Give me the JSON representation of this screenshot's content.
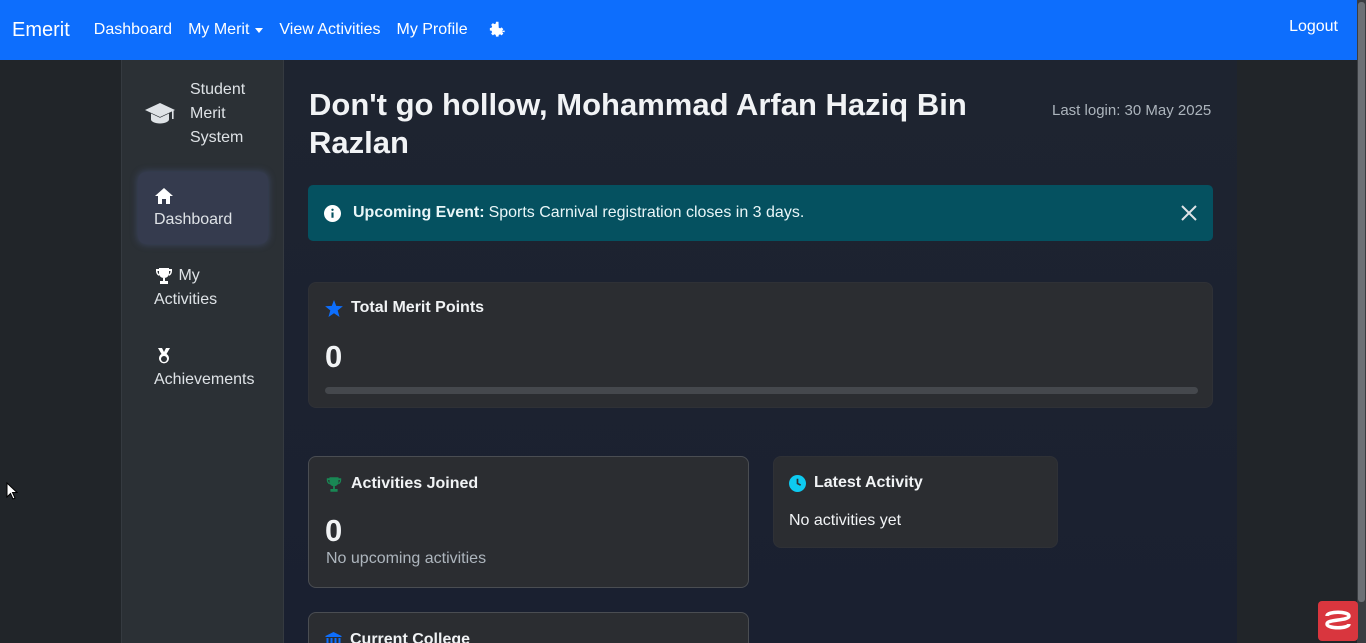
{
  "navbar": {
    "brand": "Emerit",
    "links": [
      "Dashboard",
      "My Merit",
      "View Activities",
      "My Profile"
    ],
    "logout": "Logout"
  },
  "sidebar": {
    "system_title": "Student Merit System",
    "items": [
      {
        "label": "Dashboard",
        "icon": "home-icon",
        "active": true
      },
      {
        "label": "My Activities",
        "icon": "trophy-icon",
        "active": false
      },
      {
        "label": "Achievements",
        "icon": "medal-icon",
        "active": false
      }
    ]
  },
  "main": {
    "welcome": "Don't go hollow, Mohammad Arfan Haziq Bin Razlan",
    "last_login": "Last login: 30 May 2025",
    "alert": {
      "title": "Upcoming Event:",
      "message": "Sports Carnival registration closes in 3 days."
    },
    "merit": {
      "title": "Total Merit Points",
      "value": "0",
      "progress_fraction": 0
    },
    "activities": {
      "title": "Activities Joined",
      "value": "0",
      "subtitle": "No upcoming activities"
    },
    "latest": {
      "title": "Latest Activity",
      "subtitle": "No activities yet"
    },
    "college": {
      "title": "Current College"
    }
  },
  "colors": {
    "primary": "#0d6efd",
    "alert_bg": "#055160",
    "trophy_green": "#198754",
    "clock_cyan": "#0dcaf0"
  }
}
